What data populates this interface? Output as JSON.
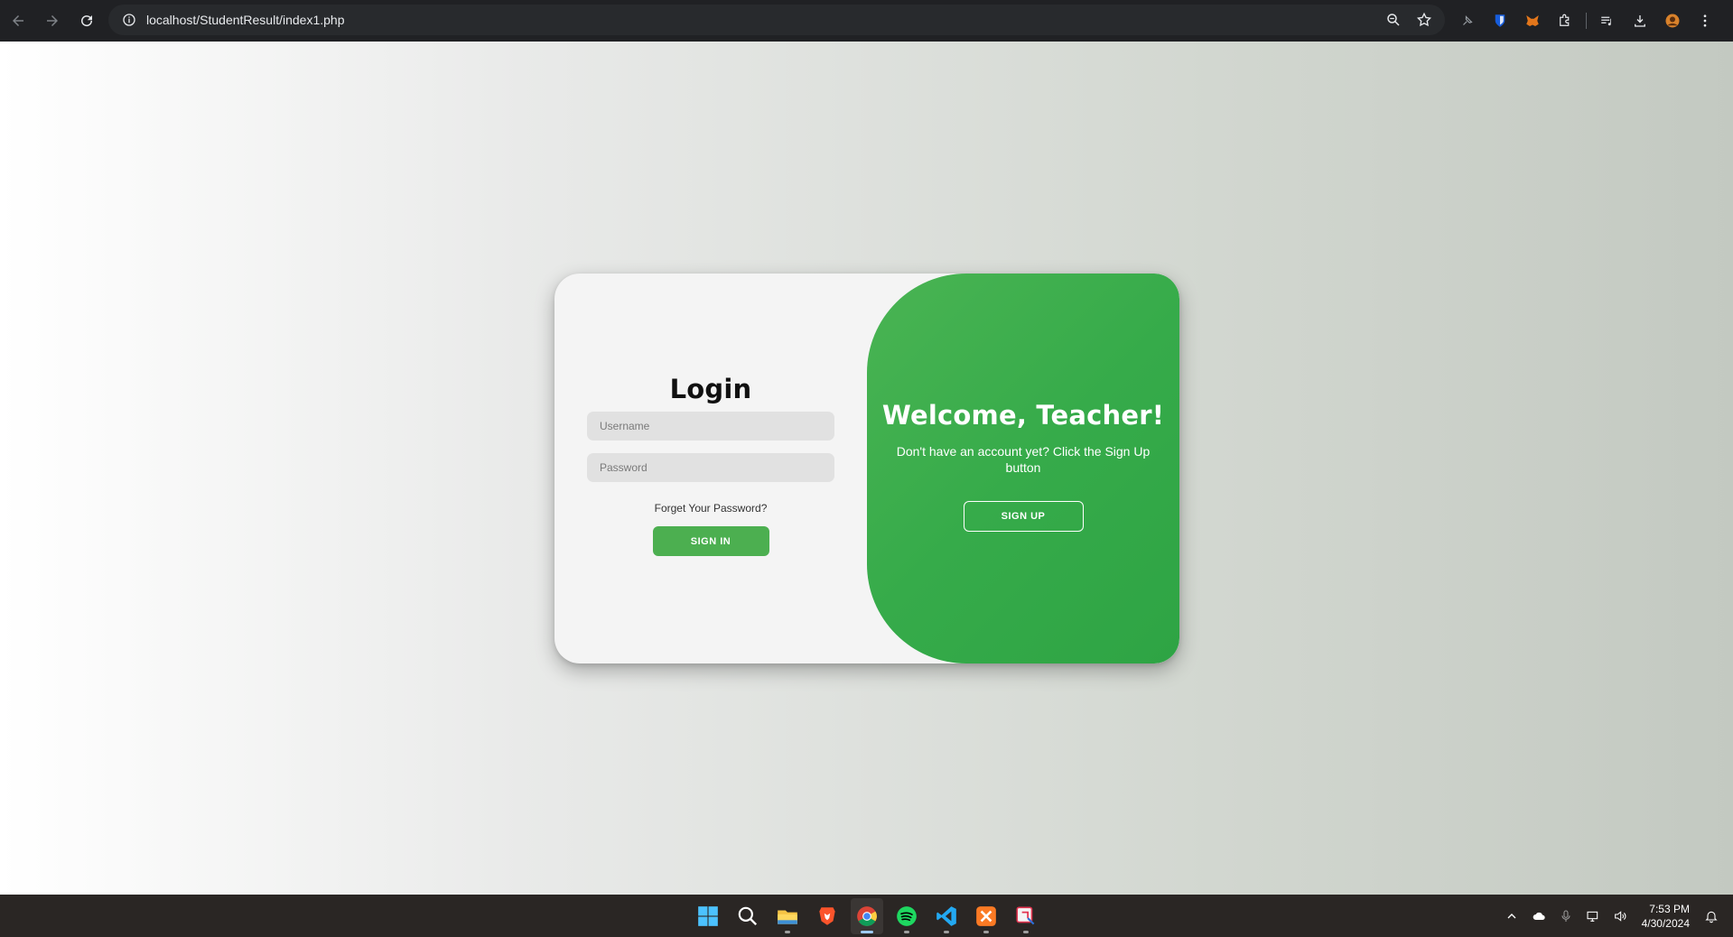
{
  "browser": {
    "url": "localhost/StudentResult/index1.php"
  },
  "login": {
    "title": "Login",
    "username_placeholder": "Username",
    "password_placeholder": "Password",
    "forgot_label": "Forget Your Password?",
    "signin_label": "SIGN IN"
  },
  "welcome": {
    "title": "Welcome, Teacher!",
    "text": "Don't have an account yet? Click the Sign Up button",
    "signup_label": "SIGN UP"
  },
  "taskbar": {
    "time": "7:53 PM",
    "date": "4/30/2024"
  },
  "colors": {
    "accent_green": "#4caf50",
    "panel_green": "#36ab4a",
    "chrome_bg": "#202124",
    "taskbar_bg": "#2a2624"
  }
}
